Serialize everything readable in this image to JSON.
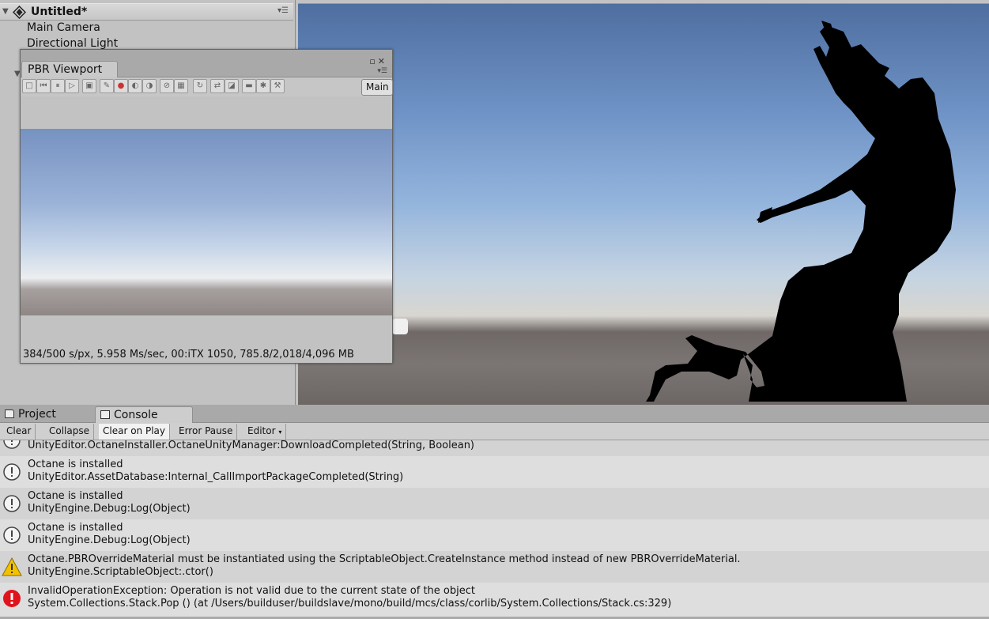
{
  "hierarchy": {
    "scene_title": "Untitled*",
    "items": [
      "Main Camera",
      "Directional Light"
    ],
    "menu_icon": "menu-lines-icon"
  },
  "pbr_window": {
    "tab_label": "PBR Viewport",
    "camera_dropdown": "Main",
    "status": "384/500 s/px, 5.958 Ms/sec, 00:iTX 1050, 785.8/2,018/4,096 MB",
    "toolbar_icons": [
      "stop-icon",
      "restart-icon",
      "pause-icon",
      "play-icon",
      "render-icon",
      "pick-focus-icon",
      "pick-material-icon",
      "pick-object-icon",
      "pick-camera-icon",
      "lock-icon",
      "region-icon",
      "reload-icon",
      "export-icon",
      "save-image-icon",
      "picture-icon",
      "settings-gear-icon",
      "wrench-icon"
    ]
  },
  "bottom": {
    "tabs": [
      {
        "label": "Project",
        "icon": "folder-icon"
      },
      {
        "label": "Console",
        "icon": "console-icon"
      }
    ],
    "toolbar": {
      "clear": "Clear",
      "collapse": "Collapse",
      "clear_on_play": "Clear on Play",
      "error_pause": "Error Pause",
      "editor": "Editor"
    },
    "logs": [
      {
        "type": "info",
        "line1": "UnityEditor.OctaneInstaller.OctaneUnityManager:DownloadCompleted(String, Boolean)",
        "line2": ""
      },
      {
        "type": "info",
        "line1": "Octane is installed",
        "line2": "UnityEditor.AssetDatabase:Internal_CallImportPackageCompleted(String)"
      },
      {
        "type": "info",
        "line1": "Octane is installed",
        "line2": "UnityEngine.Debug:Log(Object)"
      },
      {
        "type": "info",
        "line1": "Octane is installed",
        "line2": "UnityEngine.Debug:Log(Object)"
      },
      {
        "type": "warning",
        "line1": "Octane.PBROverrideMaterial must be instantiated using the ScriptableObject.CreateInstance method instead of new PBROverrideMaterial.",
        "line2": "UnityEngine.ScriptableObject:.ctor()"
      },
      {
        "type": "error",
        "line1": "InvalidOperationException: Operation is not valid due to the current state of the object",
        "line2": "System.Collections.Stack.Pop () (at /Users/builduser/buildslave/mono/build/mcs/class/corlib/System.Collections/Stack.cs:329)"
      }
    ]
  },
  "colors": {
    "warning": "#f2c200",
    "error": "#e0141c",
    "info_icon": "#444444"
  }
}
